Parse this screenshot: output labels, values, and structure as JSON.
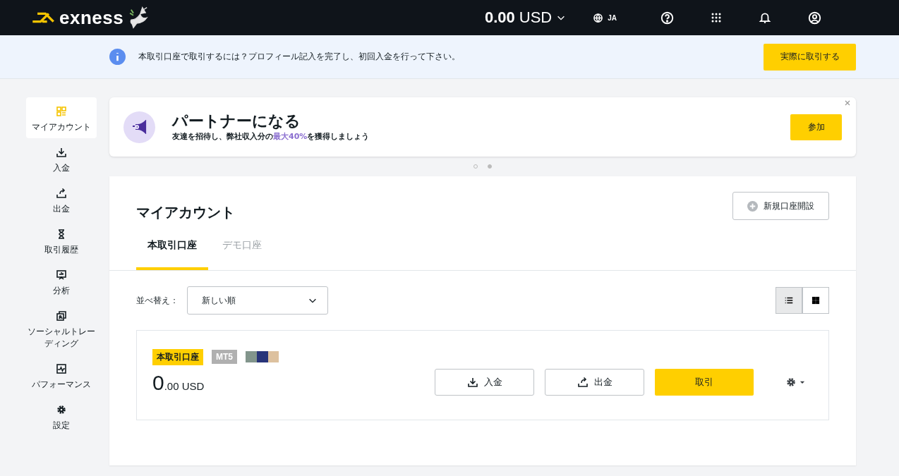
{
  "header": {
    "logo": "exness",
    "balance_amount": "0.00",
    "balance_currency": "USD",
    "language": "JA"
  },
  "notice": {
    "text": "本取引口座で取引するには？プロフィール記入を完了し、初回入金を行って下さい。",
    "button": "実際に取引する"
  },
  "sidebar": {
    "items": [
      {
        "label": "マイアカウント",
        "selected": true
      },
      {
        "label": "入金",
        "selected": false
      },
      {
        "label": "出金",
        "selected": false
      },
      {
        "label": "取引履歴",
        "selected": false
      },
      {
        "label": "分析",
        "selected": false
      },
      {
        "label": "ソーシャルトレーディング",
        "selected": false
      },
      {
        "label": "パフォーマンス",
        "selected": false
      },
      {
        "label": "設定",
        "selected": false
      }
    ]
  },
  "banner": {
    "title": "パートナーになる",
    "subtitle": "友達を招待し、弊社収入分の**最大40%**を獲得しましょう",
    "button": "参加",
    "dots": [
      {
        "selected": false
      },
      {
        "selected": true
      }
    ]
  },
  "accounts": {
    "title": "マイアカウント",
    "new_account_button": "新規口座開設",
    "tabs": [
      {
        "label": "本取引口座",
        "selected": true
      },
      {
        "label": "デモ口座",
        "selected": false
      }
    ],
    "sort_label": "並べ替え：",
    "sort_value": "新しい順",
    "views": [
      {
        "kind": "list",
        "selected": true
      },
      {
        "kind": "grid",
        "selected": false
      }
    ],
    "account": {
      "type_badge": "本取引口座",
      "platform_badge": "MT5",
      "balance_integer": "0",
      "balance_fraction": ".00 USD",
      "buttons": [
        {
          "kind": "deposit",
          "label": "入金"
        },
        {
          "kind": "withdraw",
          "label": "出金"
        },
        {
          "kind": "trade",
          "label": "取引"
        }
      ]
    }
  }
}
